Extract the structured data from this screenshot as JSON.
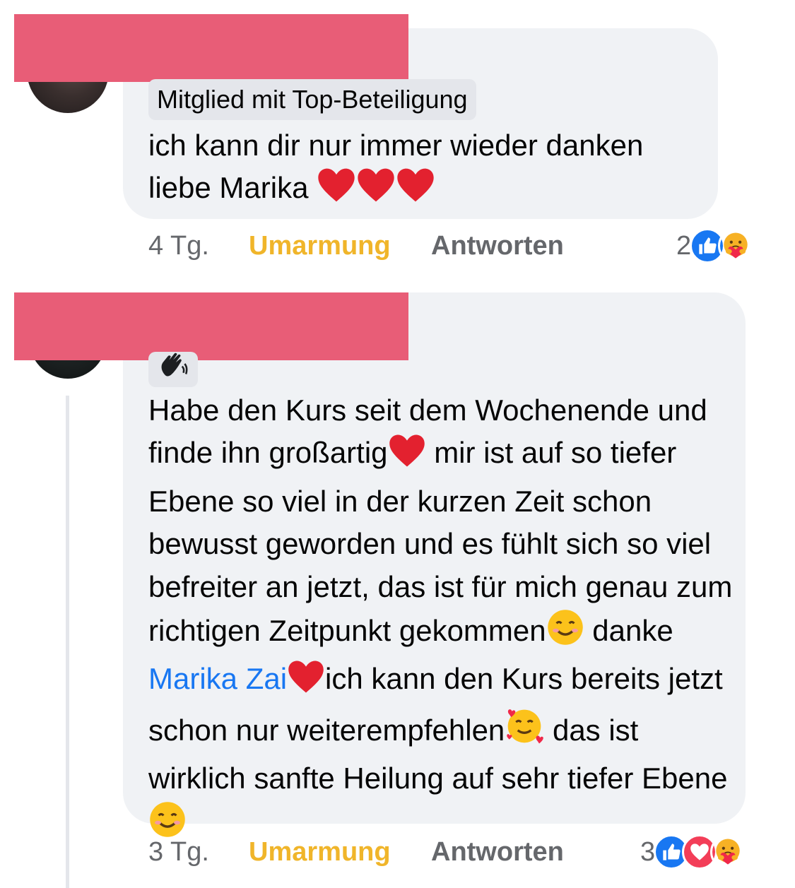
{
  "comments": [
    {
      "badge": "Mitglied mit Top-Beteiligung",
      "text_line1": "ich kann dir nur immer wieder danken",
      "text_line2": "liebe Marika ",
      "time": "4 Tg.",
      "hug_label": "Umarmung",
      "reply_label": "Antworten",
      "reaction_count": "2",
      "reactions": [
        "like-icon",
        "care-hug-icon"
      ]
    },
    {
      "badge_icon": "waving-hand-icon",
      "text_part1": "Habe den Kurs seit dem Wochenende und finde ihn großartig",
      "text_part2": " mir ist auf so tiefer Ebene so viel in der kurzen Zeit schon bewusst geworden und es fühlt sich so viel befreiter an jetzt, das ist für mich genau zum richtigen Zeitpunkt gekommen",
      "text_part3": " danke ",
      "mention": "Marika Zai",
      "text_part4": "ich kann den Kurs bereits jetzt schon nur weiterempfehlen",
      "text_part5": " das ist wirklich sanfte Heilung auf sehr tiefer Ebene",
      "time": "3 Tg.",
      "hug_label": "Umarmung",
      "reply_label": "Antworten",
      "reaction_count": "3",
      "reactions": [
        "like-icon",
        "love-icon",
        "care-hug-icon"
      ]
    }
  ],
  "colors": {
    "bubble": "#f0f2f5",
    "redaction": "#e85d77",
    "hug_action": "#f0b52a",
    "mention": "#1877f2",
    "meta_gray": "#65676b"
  }
}
